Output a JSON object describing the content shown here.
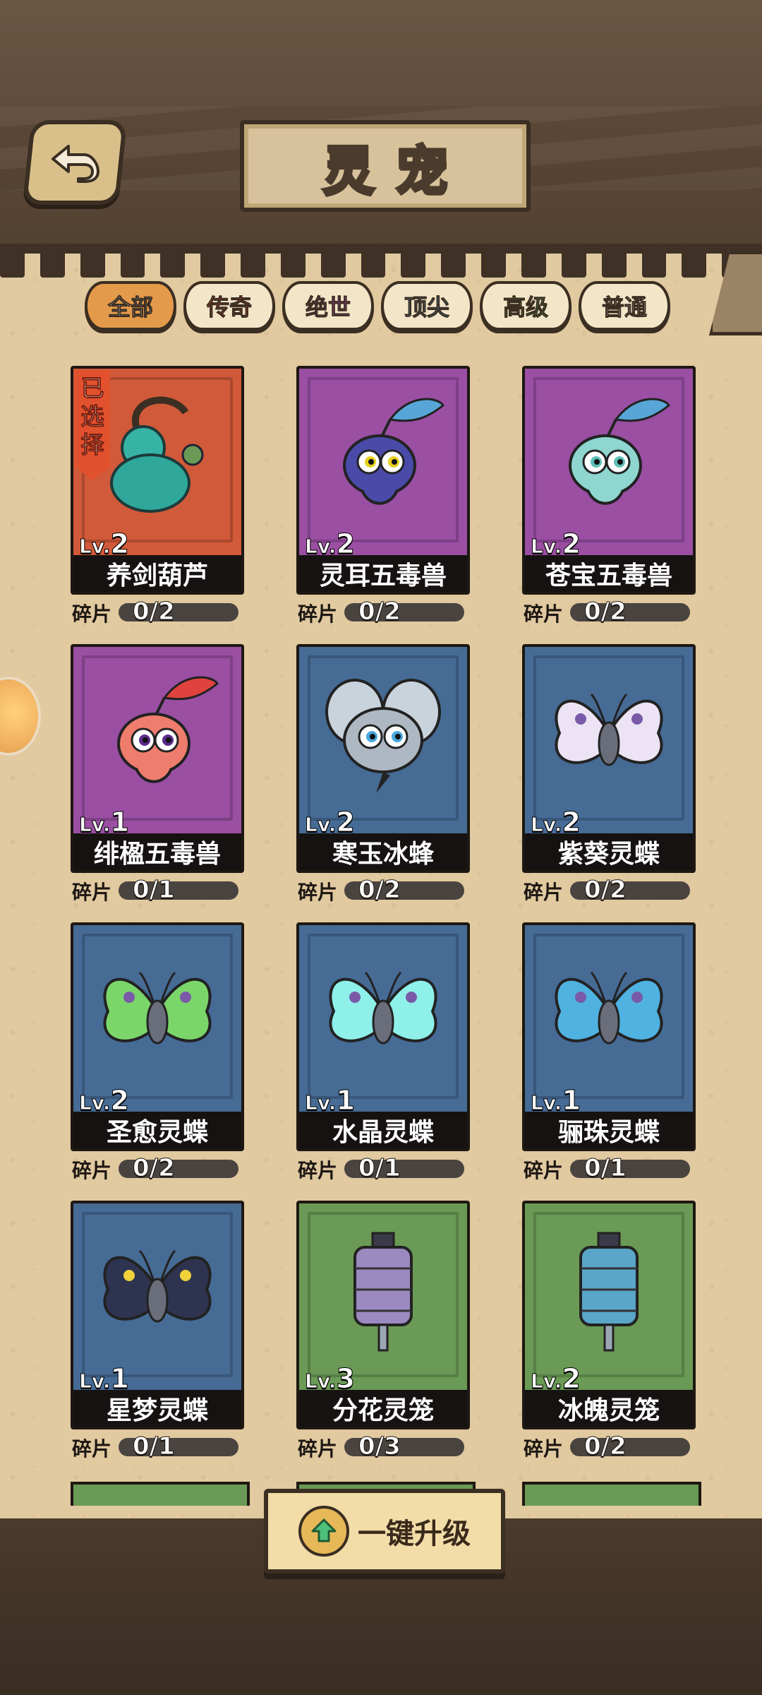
{
  "header": {
    "title": "灵宠",
    "back_icon": "back-arrow-icon"
  },
  "tabs": [
    {
      "label": "全部",
      "color": "#ffffff",
      "active": true
    },
    {
      "label": "传奇",
      "color": "#e8432f",
      "active": false
    },
    {
      "label": "绝世",
      "color": "#d23fd8",
      "active": false
    },
    {
      "label": "顶尖",
      "color": "#3d9ee0",
      "active": false
    },
    {
      "label": "高级",
      "color": "#3fae3b",
      "active": false
    },
    {
      "label": "普通",
      "color": "#ffffff",
      "active": false
    }
  ],
  "colors": {
    "orange_card": "#d15a3a",
    "purple_card": "#9a4fa3",
    "blue_card": "#466b95",
    "green_card": "#6a9a55"
  },
  "selected_label": "已选择",
  "fragment_label": "碎片",
  "pets": [
    {
      "name": "养剑葫芦",
      "lv_prefix": "Lv.",
      "lv": "2",
      "fragments": "0/2",
      "card_color": "#d15a3a",
      "icon": "gourd-icon",
      "selected": true
    },
    {
      "name": "灵耳五毒兽",
      "lv_prefix": "Lv.",
      "lv": "2",
      "fragments": "0/2",
      "card_color": "#9a4fa3",
      "icon": "purple-creature-icon"
    },
    {
      "name": "苍宝五毒兽",
      "lv_prefix": "Lv.",
      "lv": "2",
      "fragments": "0/2",
      "card_color": "#9a4fa3",
      "icon": "teal-creature-icon"
    },
    {
      "name": "绯楹五毒兽",
      "lv_prefix": "Lv.",
      "lv": "1",
      "fragments": "0/1",
      "card_color": "#9a4fa3",
      "icon": "red-creature-icon"
    },
    {
      "name": "寒玉冰蜂",
      "lv_prefix": "Lv.",
      "lv": "2",
      "fragments": "0/2",
      "card_color": "#466b95",
      "icon": "ice-bee-icon"
    },
    {
      "name": "紫葵灵蝶",
      "lv_prefix": "Lv.",
      "lv": "2",
      "fragments": "0/2",
      "card_color": "#466b95",
      "icon": "white-butterfly-icon"
    },
    {
      "name": "圣愈灵蝶",
      "lv_prefix": "Lv.",
      "lv": "2",
      "fragments": "0/2",
      "card_color": "#466b95",
      "icon": "green-butterfly-icon"
    },
    {
      "name": "水晶灵蝶",
      "lv_prefix": "Lv.",
      "lv": "1",
      "fragments": "0/1",
      "card_color": "#466b95",
      "icon": "cyan-butterfly-icon"
    },
    {
      "name": "骊珠灵蝶",
      "lv_prefix": "Lv.",
      "lv": "1",
      "fragments": "0/1",
      "card_color": "#466b95",
      "icon": "blue-butterfly-icon"
    },
    {
      "name": "星梦灵蝶",
      "lv_prefix": "Lv.",
      "lv": "1",
      "fragments": "0/1",
      "card_color": "#466b95",
      "icon": "dark-butterfly-icon"
    },
    {
      "name": "分花灵笼",
      "lv_prefix": "Lv.",
      "lv": "3",
      "fragments": "0/3",
      "card_color": "#6a9a55",
      "icon": "purple-lantern-icon"
    },
    {
      "name": "冰魄灵笼",
      "lv_prefix": "Lv.",
      "lv": "2",
      "fragments": "0/2",
      "card_color": "#6a9a55",
      "icon": "blue-lantern-icon"
    }
  ],
  "upgrade_button": {
    "label": "一键升级",
    "icon": "upgrade-arrow-icon"
  }
}
